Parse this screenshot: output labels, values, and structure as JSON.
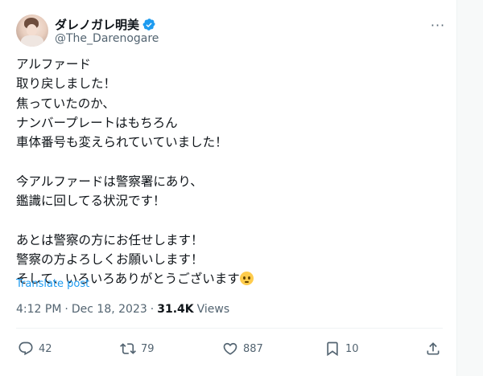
{
  "tweet": {
    "display_name": "ダレノガレ明美",
    "handle": "@The_Darenogare",
    "body": "アルファード\n取り戻しました！\n焦っていたのか、\nナンバープレートはもちろん\n車体番号も変えられていていました！\n\n今アルファードは警察署にあり、\n鑑識に回してる状況です！\n\nあとは警察の方にお任せします！\n警察の方よろしくお願いします！\nそして、いろいろありがとうございます",
    "translate_label": "Translate post",
    "time": "4:12 PM",
    "separator": "·",
    "date": "Dec 18, 2023",
    "views_count": "31.4K",
    "views_label": "Views",
    "more_label": "···"
  },
  "actions": {
    "replies": "42",
    "reposts": "79",
    "likes": "887",
    "bookmarks": "10"
  },
  "colors": {
    "accent": "#1d9bf0",
    "text": "#0f1419",
    "secondary": "#536471"
  }
}
